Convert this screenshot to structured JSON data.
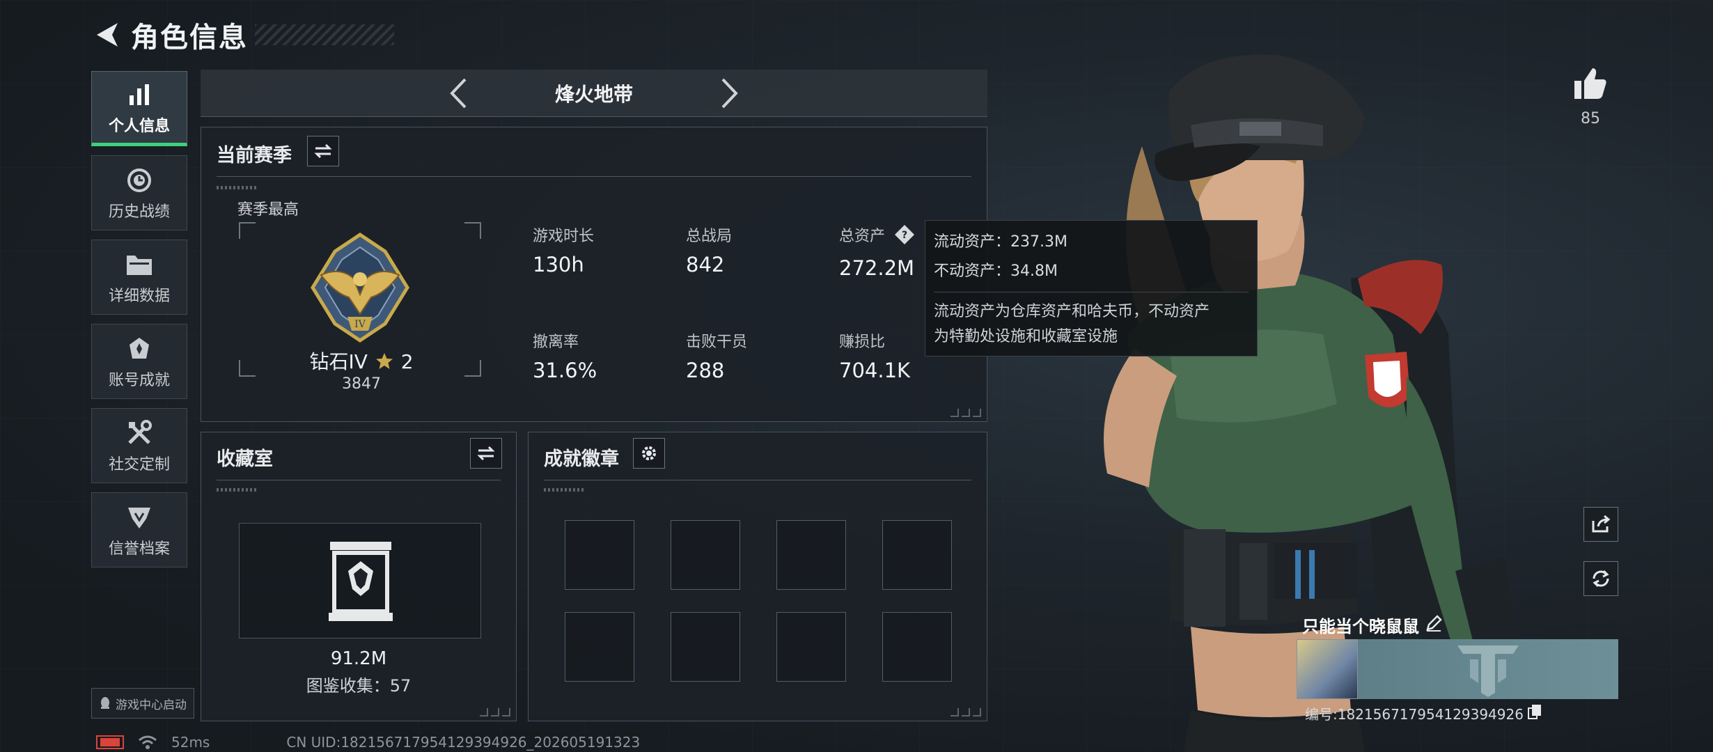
{
  "header": {
    "title": "角色信息"
  },
  "nav": {
    "items": [
      {
        "label": "个人信息",
        "icon": "bar-chart-icon",
        "active": true
      },
      {
        "label": "历史战绩",
        "icon": "history-icon",
        "active": false
      },
      {
        "label": "详细数据",
        "icon": "folder-icon",
        "active": false
      },
      {
        "label": "账号成就",
        "icon": "achievement-icon",
        "active": false
      },
      {
        "label": "社交定制",
        "icon": "tools-icon",
        "active": false
      },
      {
        "label": "信誉档案",
        "icon": "credit-shield-icon",
        "active": false
      }
    ],
    "launch_label": "游戏中心启动"
  },
  "mode": {
    "title": "烽火地带"
  },
  "season": {
    "title": "当前赛季",
    "best_label": "赛季最高",
    "rank_name": "钻石IV",
    "rank_stars": "2",
    "rank_score": "3847",
    "stats": [
      {
        "label": "游戏时长",
        "value": "130h"
      },
      {
        "label": "总战局",
        "value": "842"
      },
      {
        "label": "总资产",
        "value": "272.2M"
      },
      {
        "label": "撤离率",
        "value": "31.6%"
      },
      {
        "label": "击败干员",
        "value": "288"
      },
      {
        "label": "赚损比",
        "value": "704.1K"
      }
    ]
  },
  "tooltip": {
    "liquid": "流动资产：237.3M",
    "fixed": "不动资产：34.8M",
    "desc_line1": "流动资产为仓库资产和哈夫币，不动资产",
    "desc_line2": "为特勤处设施和收藏室设施"
  },
  "collection": {
    "title": "收藏室",
    "value": "91.2M",
    "count": "图鉴收集：57"
  },
  "badges": {
    "title": "成就徽章"
  },
  "like": {
    "count": "85"
  },
  "player": {
    "name": "只能当个晓鼠鼠",
    "uid": "编号:1821567179541293949​26"
  },
  "footer": {
    "ping": "52ms",
    "cn_uid": "CN UID:182156717954129394926_202605191323"
  },
  "colors": {
    "accent": "#3ed07c",
    "gold": "#c9a94a",
    "panel": "#1c2228"
  }
}
